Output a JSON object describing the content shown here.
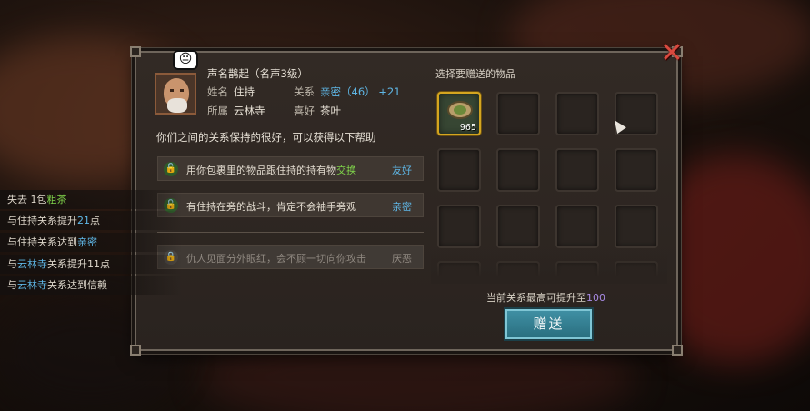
{
  "npc": {
    "emote": "😐",
    "reputation_label": "声名鹊起",
    "reputation_level": "（名声3级）",
    "name_label": "姓名",
    "name": "住持",
    "relation_label": "关系",
    "relation": "亲密",
    "relation_points": "（46）",
    "relation_delta": "+21",
    "affiliation_label": "所属",
    "affiliation": "云林寺",
    "hobby_label": "喜好",
    "hobby": "茶叶"
  },
  "relation_desc": "你们之间的关系保持的很好，可以获得以下帮助",
  "benefits": [
    {
      "text_a": "用你包裹里的物品跟住持的持有物",
      "text_b": "交换",
      "tier": "友好",
      "locked": false
    },
    {
      "text_a": "有住持在旁的战斗，肯定不会袖手旁观",
      "text_b": "",
      "tier": "亲密",
      "locked": false
    },
    {
      "text_a": "仇人见面分外眼红，会不顾一切向你攻击",
      "text_b": "",
      "tier": "厌恶",
      "locked": true
    }
  ],
  "gift_panel": {
    "title": "选择要赠送的物品",
    "item": {
      "icon": "tea-leaf-icon",
      "count": "965"
    },
    "max_note_a": "当前关系最高可提升至",
    "max_note_b": "100",
    "gift_button": "赠送"
  },
  "close_label": "✕",
  "log": [
    {
      "a": "失去 1包",
      "b": "粗茶",
      "c": "",
      "color_b": "green"
    },
    {
      "a": "与住持关系提升",
      "b": "21",
      "c": "点",
      "color_b": "blue"
    },
    {
      "a": "与住持关系达到",
      "b": "亲密",
      "c": "",
      "color_b": "blue"
    },
    {
      "a": "与",
      "b": "云林寺",
      "c": "关系提升11点",
      "color_b": "blue"
    },
    {
      "a": "与",
      "b": "云林寺",
      "c": "关系达到信赖",
      "color_b": "blue"
    }
  ],
  "colors": {
    "accent_gold": "#d4a520",
    "positive_green": "#7fd34a",
    "relation_blue": "#5fb7e6",
    "cap_purple": "#a98be6",
    "close_red": "#d94a3f",
    "gift_button": "#3f8fa3"
  }
}
